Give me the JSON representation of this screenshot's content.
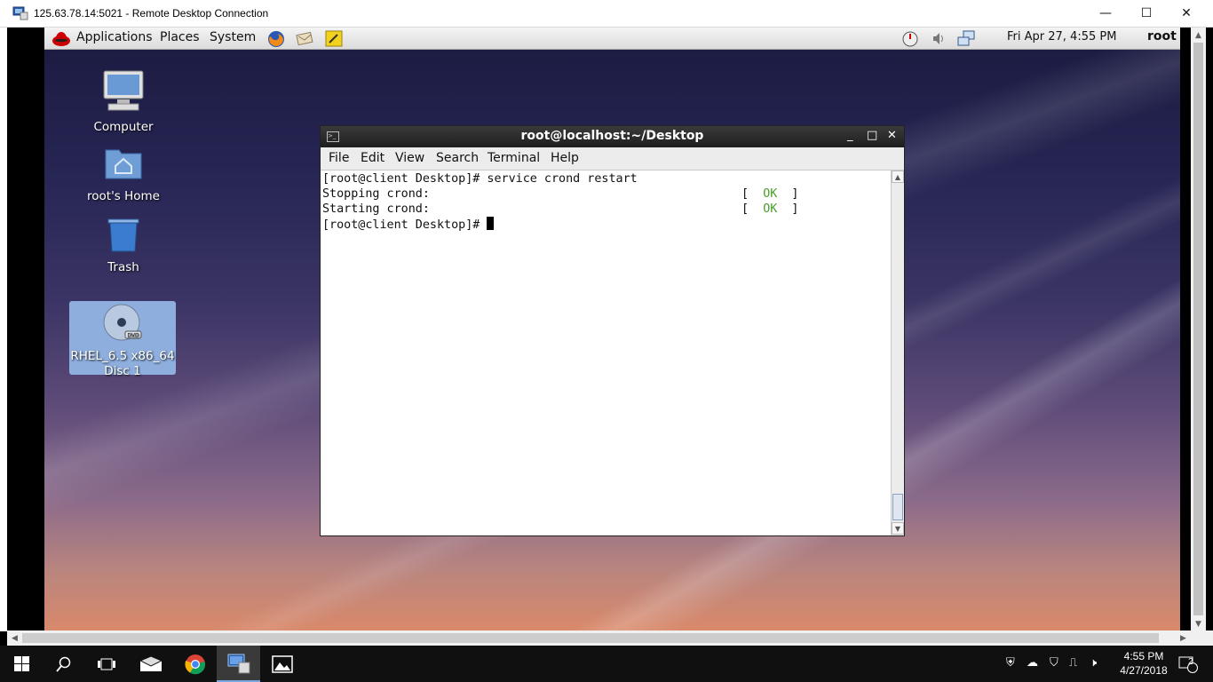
{
  "rdp": {
    "title": "125.63.78.14:5021 - Remote Desktop Connection",
    "minimize": "—",
    "maximize": "☐",
    "close": "✕"
  },
  "panel": {
    "menus": [
      "Applications",
      "Places",
      "System"
    ],
    "clock": "Fri Apr 27,  4:55 PM",
    "user": "root"
  },
  "desktop_icons": [
    {
      "label": "Computer",
      "icon": "computer-icon"
    },
    {
      "label": "root's Home",
      "icon": "home-folder-icon"
    },
    {
      "label": "Trash",
      "icon": "trash-icon"
    },
    {
      "label": "RHEL_6.5 x86_64\nDisc 1",
      "icon": "dvd-icon",
      "selected": true
    }
  ],
  "terminal": {
    "title": "root@localhost:~/Desktop",
    "menu": [
      "File",
      "Edit",
      "View",
      "Search",
      "Terminal",
      "Help"
    ],
    "lines": [
      {
        "text": "[root@client Desktop]# service crond restart"
      },
      {
        "text": "Stopping crond:",
        "status": "OK"
      },
      {
        "text": "Starting crond:",
        "status": "OK"
      },
      {
        "text": "[root@client Desktop]# ",
        "cursor": true
      }
    ],
    "ok_color": "#4aa02c"
  },
  "taskbar": {
    "time": "4:55 PM",
    "date": "4/27/2018",
    "notifications": "2"
  }
}
